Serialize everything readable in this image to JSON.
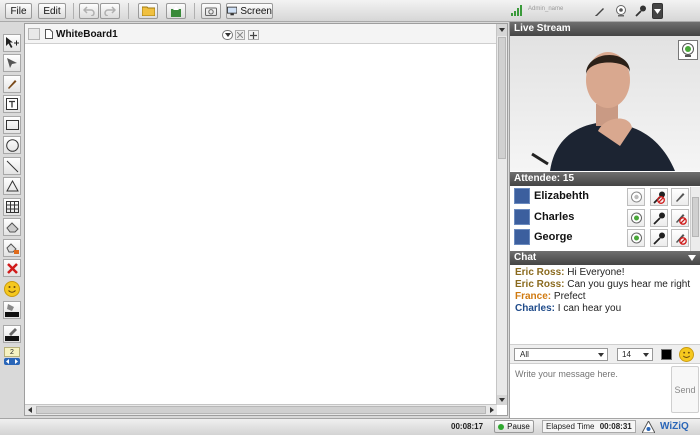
{
  "toolbar": {
    "file": "File",
    "edit": "Edit",
    "screen": "Screen",
    "user_name": "Admin_name"
  },
  "whiteboard": {
    "tab_title": "WhiteBoard1",
    "page_number": "2"
  },
  "livestream": {
    "title": "Live Stream"
  },
  "attendees": {
    "title": "Attendee: 15",
    "items": [
      {
        "name": "Elizabehth"
      },
      {
        "name": "Charles"
      },
      {
        "name": "George"
      }
    ]
  },
  "chat": {
    "title": "Chat",
    "messages": [
      {
        "sender": "Eric Ross:",
        "text": "Hi Everyone!",
        "color": "#8a6a1e"
      },
      {
        "sender": "Eric Ross:",
        "text": "Can you guys hear me right",
        "color": "#8a6a1e"
      },
      {
        "sender": "France:",
        "text": "Prefect",
        "color": "#d07a10"
      },
      {
        "sender": "Charles:",
        "text": "I can hear you",
        "color": "#1f4b8a"
      }
    ],
    "to": "All",
    "font_size": "14",
    "placeholder": "Write your message here.",
    "send": "Send"
  },
  "status": {
    "timer": "00:08:17",
    "pause": "Pause",
    "elapsed_label": "Elapsed Time",
    "elapsed": "00:08:31",
    "brand": "WiZiQ"
  },
  "colors": {
    "accent": "#2a66b8",
    "header_dark": "#4f4f4f"
  }
}
